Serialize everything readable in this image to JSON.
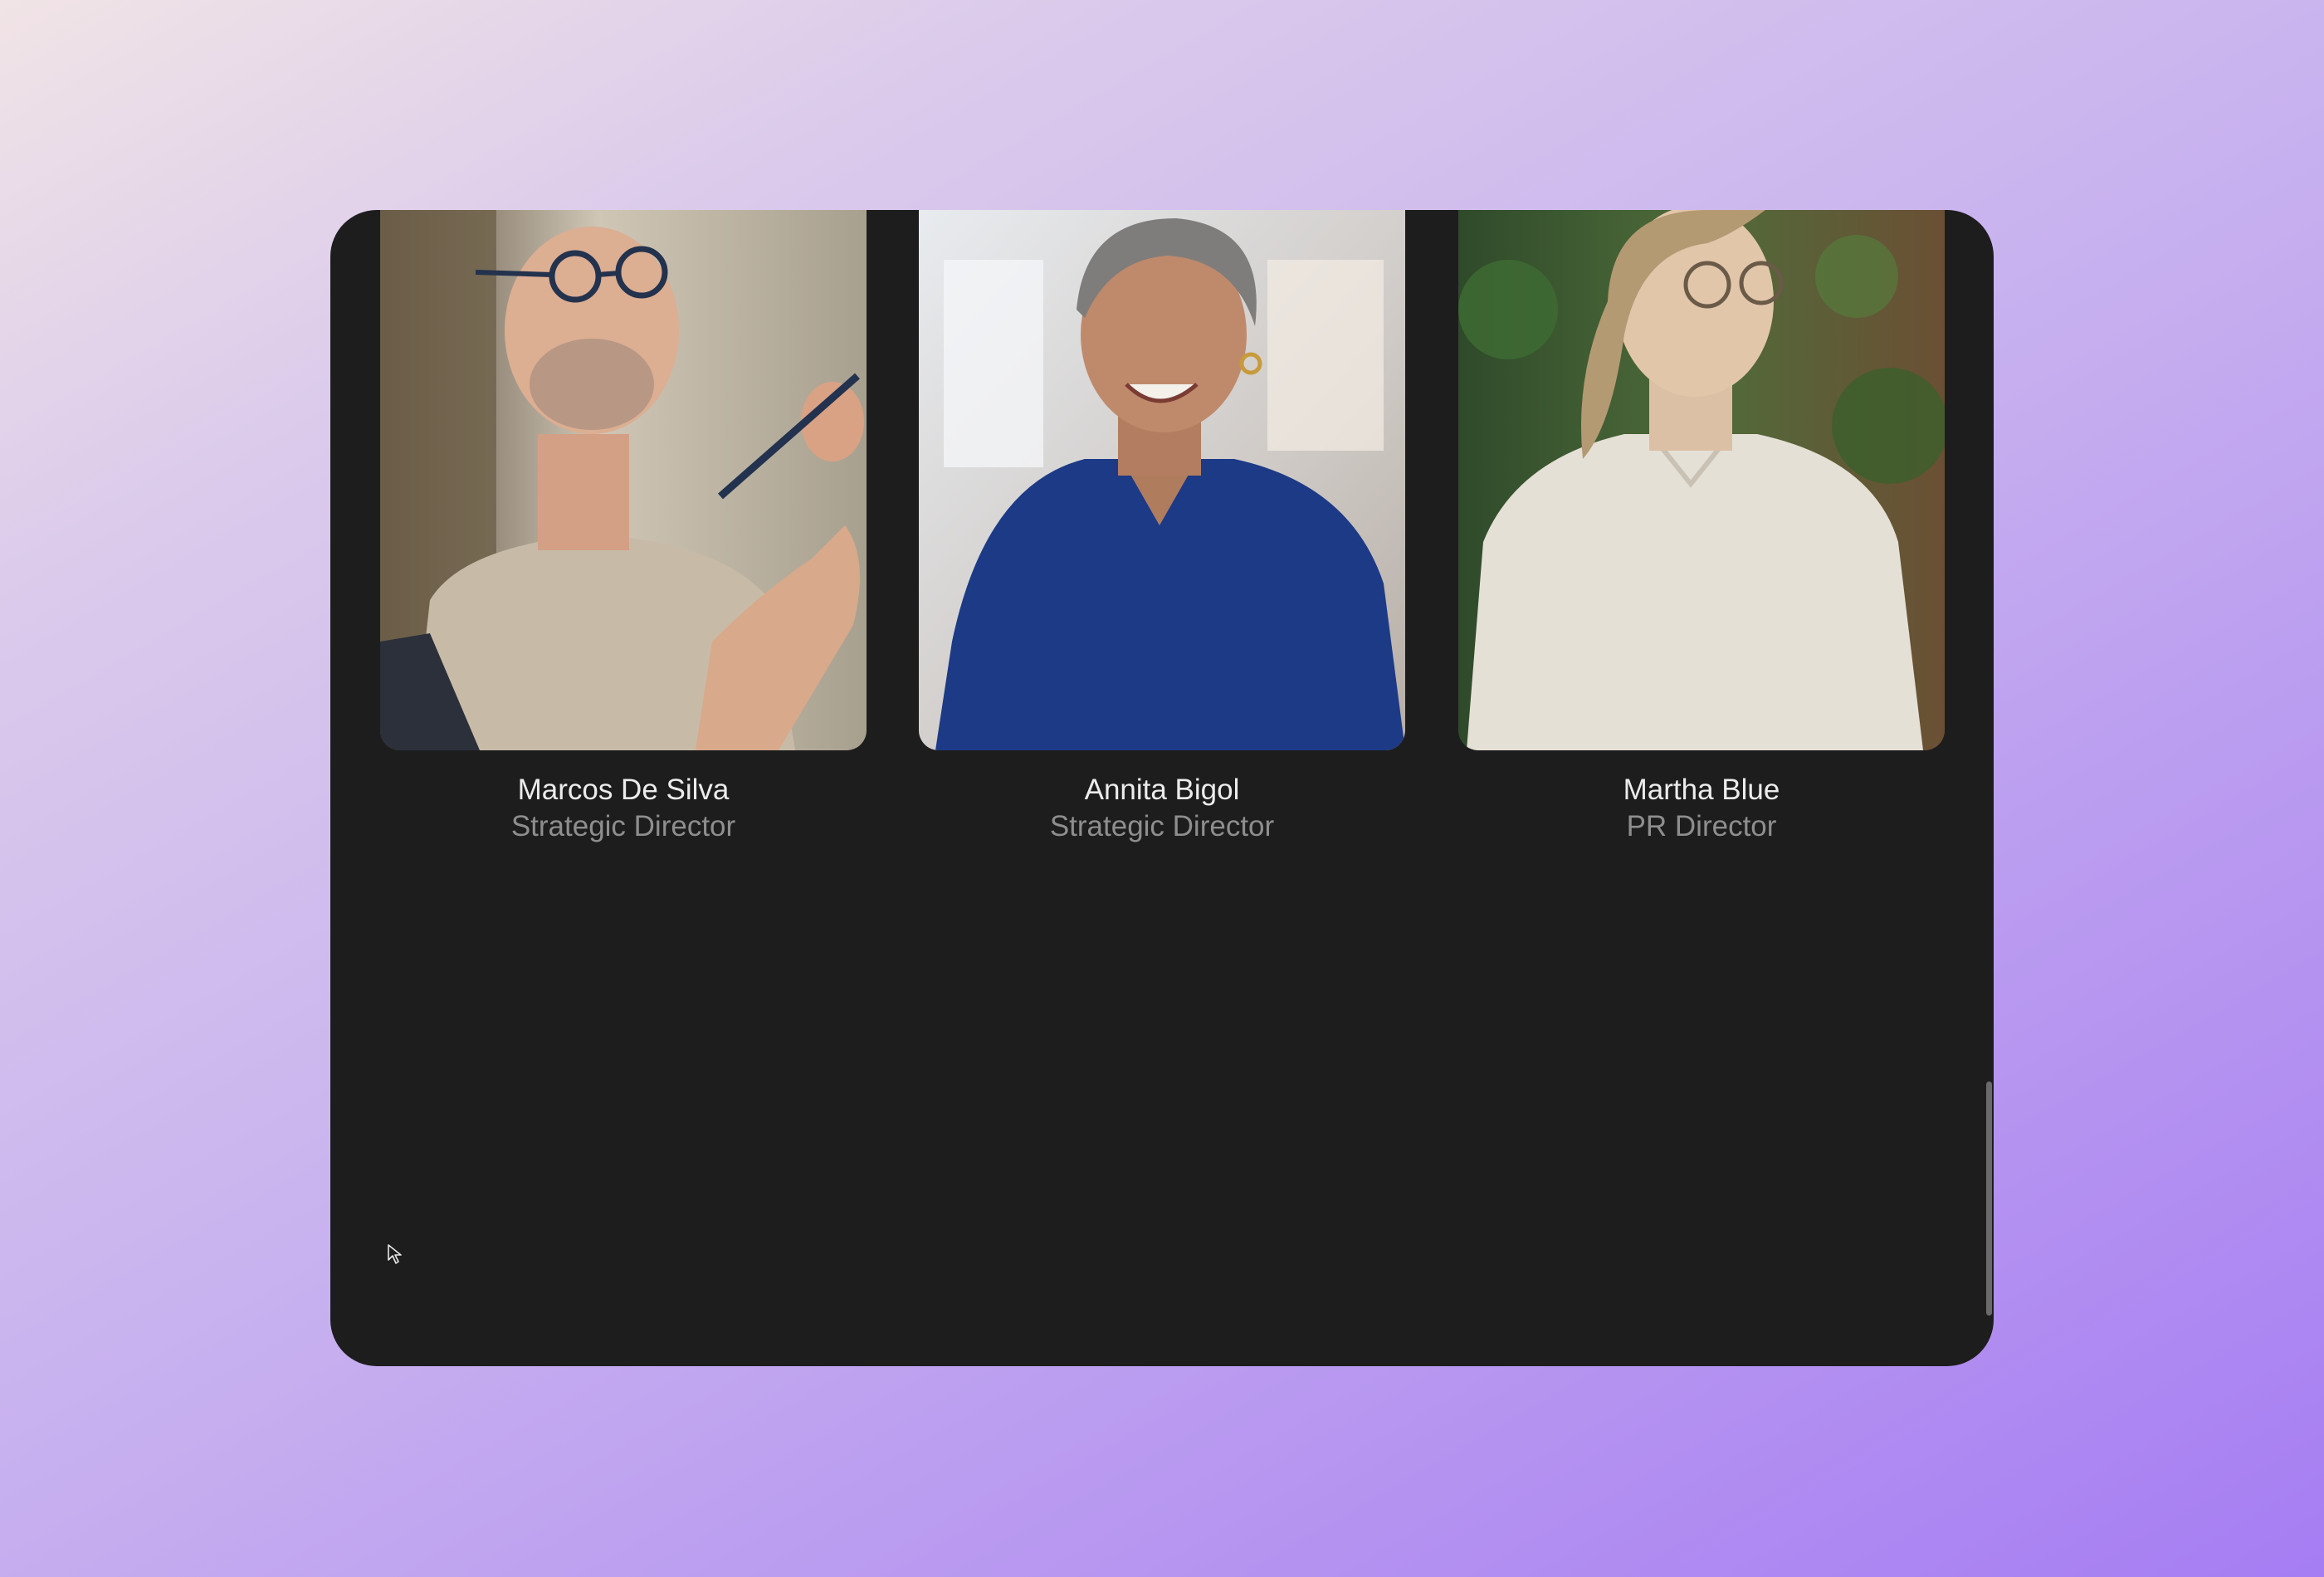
{
  "team": [
    {
      "name": "Marcos De Silva",
      "role": "Strategic Director"
    },
    {
      "name": "Annita Bigol",
      "role": "Strategic Director"
    },
    {
      "name": "Martha Blue",
      "role": "PR Director"
    }
  ],
  "colors": {
    "panel_background": "#1d1d1e",
    "name_text": "#ececec",
    "role_text": "#8e8e8e"
  },
  "icons": {
    "cursor": "mouse-pointer-icon"
  }
}
